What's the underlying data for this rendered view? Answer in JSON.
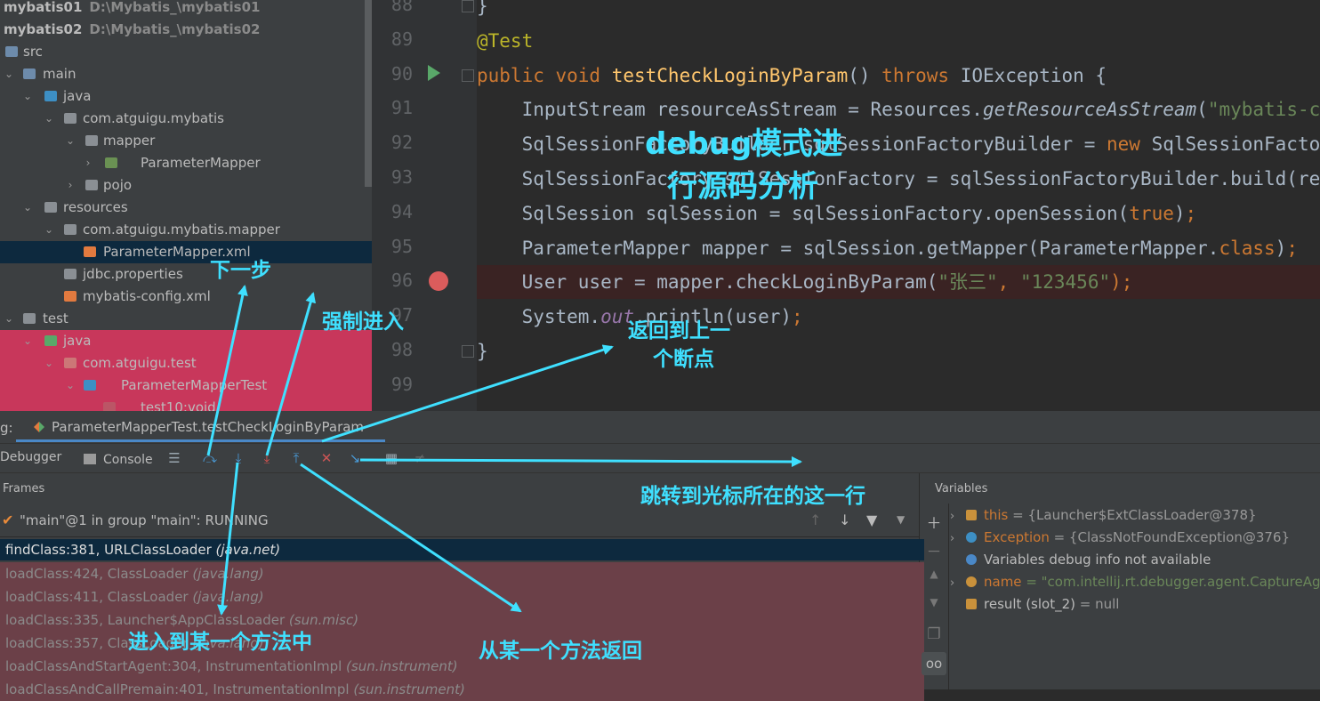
{
  "tree": {
    "rows": [
      {
        "label": "mybatis01",
        "sub": "D:\\Mybatis_\\mybatis01"
      },
      {
        "label": "mybatis02",
        "sub": "D:\\Mybatis_\\mybatis02"
      },
      {
        "label": "src"
      },
      {
        "label": "main"
      },
      {
        "label": "java"
      },
      {
        "label": "com.atguigu.mybatis"
      },
      {
        "label": "mapper"
      },
      {
        "label": "ParameterMapper"
      },
      {
        "label": "pojo"
      },
      {
        "label": "resources"
      },
      {
        "label": "com.atguigu.mybatis.mapper"
      },
      {
        "label": "ParameterMapper.xml"
      },
      {
        "label": "jdbc.properties"
      },
      {
        "label": "mybatis-config.xml"
      },
      {
        "label": "test"
      },
      {
        "label": "java"
      },
      {
        "label": "com.atguigu.test"
      },
      {
        "label": "ParameterMapperTest"
      },
      {
        "label": "test10:void"
      }
    ]
  },
  "editor": {
    "line_numbers": [
      "88",
      "89",
      "90",
      "91",
      "92",
      "93",
      "94",
      "95",
      "96",
      "97",
      "98",
      "99"
    ],
    "lines": [
      {
        "p": [
          {
            "t": "}",
            "c": ""
          }
        ]
      },
      {
        "p": [
          {
            "t": "@Test",
            "c": "ann"
          }
        ]
      },
      {
        "p": [
          {
            "t": "public void ",
            "c": "kw"
          },
          {
            "t": "testCheckLoginByParam",
            "c": "fn"
          },
          {
            "t": "() ",
            "c": ""
          },
          {
            "t": "throws ",
            "c": "kw"
          },
          {
            "t": "IOException {",
            "c": ""
          }
        ]
      },
      {
        "p": [
          {
            "t": "    InputStream resourceAsStream = Resources.",
            "c": ""
          },
          {
            "t": "getResourceAsStream",
            "c": "it"
          },
          {
            "t": "(",
            "c": ""
          },
          {
            "t": "\"mybatis-config.xml\"",
            "c": "st"
          },
          {
            "t": ");",
            "c": "kw"
          }
        ]
      },
      {
        "p": [
          {
            "t": "    SqlSessionFactoryBuilder sqlSessionFactoryBuilder = ",
            "c": ""
          },
          {
            "t": "new ",
            "c": "kw"
          },
          {
            "t": "SqlSessionFactoryBuilder()",
            "c": ""
          },
          {
            "t": ";",
            "c": "kw"
          }
        ]
      },
      {
        "p": [
          {
            "t": "    SqlSessionFactory sqlSessionFactory = sqlSessionFactoryBuilder.build(resourceAsStream)",
            "c": ""
          },
          {
            "t": ";",
            "c": "kw"
          }
        ]
      },
      {
        "p": [
          {
            "t": "    SqlSession sqlSession = sqlSessionFactory.openSession(",
            "c": ""
          },
          {
            "t": "true",
            "c": "kw"
          },
          {
            "t": ")",
            "c": ""
          },
          {
            "t": ";",
            "c": "kw"
          }
        ]
      },
      {
        "p": [
          {
            "t": "    ParameterMapper mapper = sqlSession.getMapper(ParameterMapper.",
            "c": ""
          },
          {
            "t": "class",
            "c": "kw"
          },
          {
            "t": ")",
            "c": ""
          },
          {
            "t": ";",
            "c": "kw"
          }
        ]
      },
      {
        "p": [
          {
            "t": "    User user = mapper.checkLoginByParam(",
            "c": ""
          },
          {
            "t": "\"张三\"",
            "c": "st"
          },
          {
            "t": ", ",
            "c": "kw"
          },
          {
            "t": "\"123456\"",
            "c": "st"
          },
          {
            "t": ");",
            "c": "kw"
          }
        ]
      },
      {
        "p": [
          {
            "t": "    System.",
            "c": ""
          },
          {
            "t": "out",
            "c": "pu"
          },
          {
            "t": ".println(user)",
            "c": ""
          },
          {
            "t": ";",
            "c": "kw"
          }
        ]
      },
      {
        "p": [
          {
            "t": "}",
            "c": ""
          }
        ]
      },
      {
        "p": [
          {
            "t": "",
            "c": ""
          }
        ]
      }
    ]
  },
  "debug": {
    "tab_prefix": "g:",
    "session_tab": "ParameterMapperTest.testCheckLoginByParam",
    "tab_debugger": "Debugger",
    "tab_console": "Console",
    "frames_header": "Frames",
    "variables_header": "Variables",
    "thread": "\"main\"@1 in group \"main\": RUNNING",
    "frames": [
      {
        "method": "findClass:381, URLClassLoader ",
        "pkg": "(java.net)"
      },
      {
        "method": "loadClass:424, ClassLoader ",
        "pkg": "(java.lang)"
      },
      {
        "method": "loadClass:411, ClassLoader ",
        "pkg": "(java.lang)"
      },
      {
        "method": "loadClass:335, Launcher$AppClassLoader ",
        "pkg": "(sun.misc)"
      },
      {
        "method": "loadClass:357, ClassLoader ",
        "pkg": "(java.lang)"
      },
      {
        "method": "loadClassAndStartAgent:304, InstrumentationImpl ",
        "pkg": "(sun.instrument)"
      },
      {
        "method": "loadClassAndCallPremain:401, InstrumentationImpl ",
        "pkg": "(sun.instrument)"
      }
    ],
    "variables": [
      {
        "name": "this",
        "value": " = {Launcher$ExtClassLoader@378}",
        "color": "#cc7832",
        "icon": "field-icon"
      },
      {
        "name": "Exception",
        "value": " = {ClassNotFoundException@376}",
        "color": "#cc7832",
        "icon": "exception-icon"
      },
      {
        "name": "Variables debug info not available",
        "value": "",
        "color": "#bbbbbb",
        "icon": "info-icon"
      },
      {
        "name": "name",
        "value": " = \"com.intellij.rt.debugger.agent.CaptureAgent\"",
        "color": "#cc7832",
        "icon": "param-icon"
      },
      {
        "name": "result (slot_2)",
        "value": " = null",
        "color": "#bbbbbb",
        "icon": "field-icon"
      }
    ]
  },
  "notes": {
    "title1": "debug模式进",
    "title2": "行源码分析",
    "step_over": "下一步",
    "force_step_into": "强制进入",
    "resume1": "返回到上一",
    "resume2": "个断点",
    "run_to_cursor": "跳转到光标所在的这一行",
    "step_into": "进入到某一个方法中",
    "step_out": "从某一个方法返回"
  },
  "colors": {
    "annotation": "#3fe0ff",
    "breakpoint": "#db5c5c",
    "selection": "#0d293e",
    "highlight": "#c8375b"
  }
}
